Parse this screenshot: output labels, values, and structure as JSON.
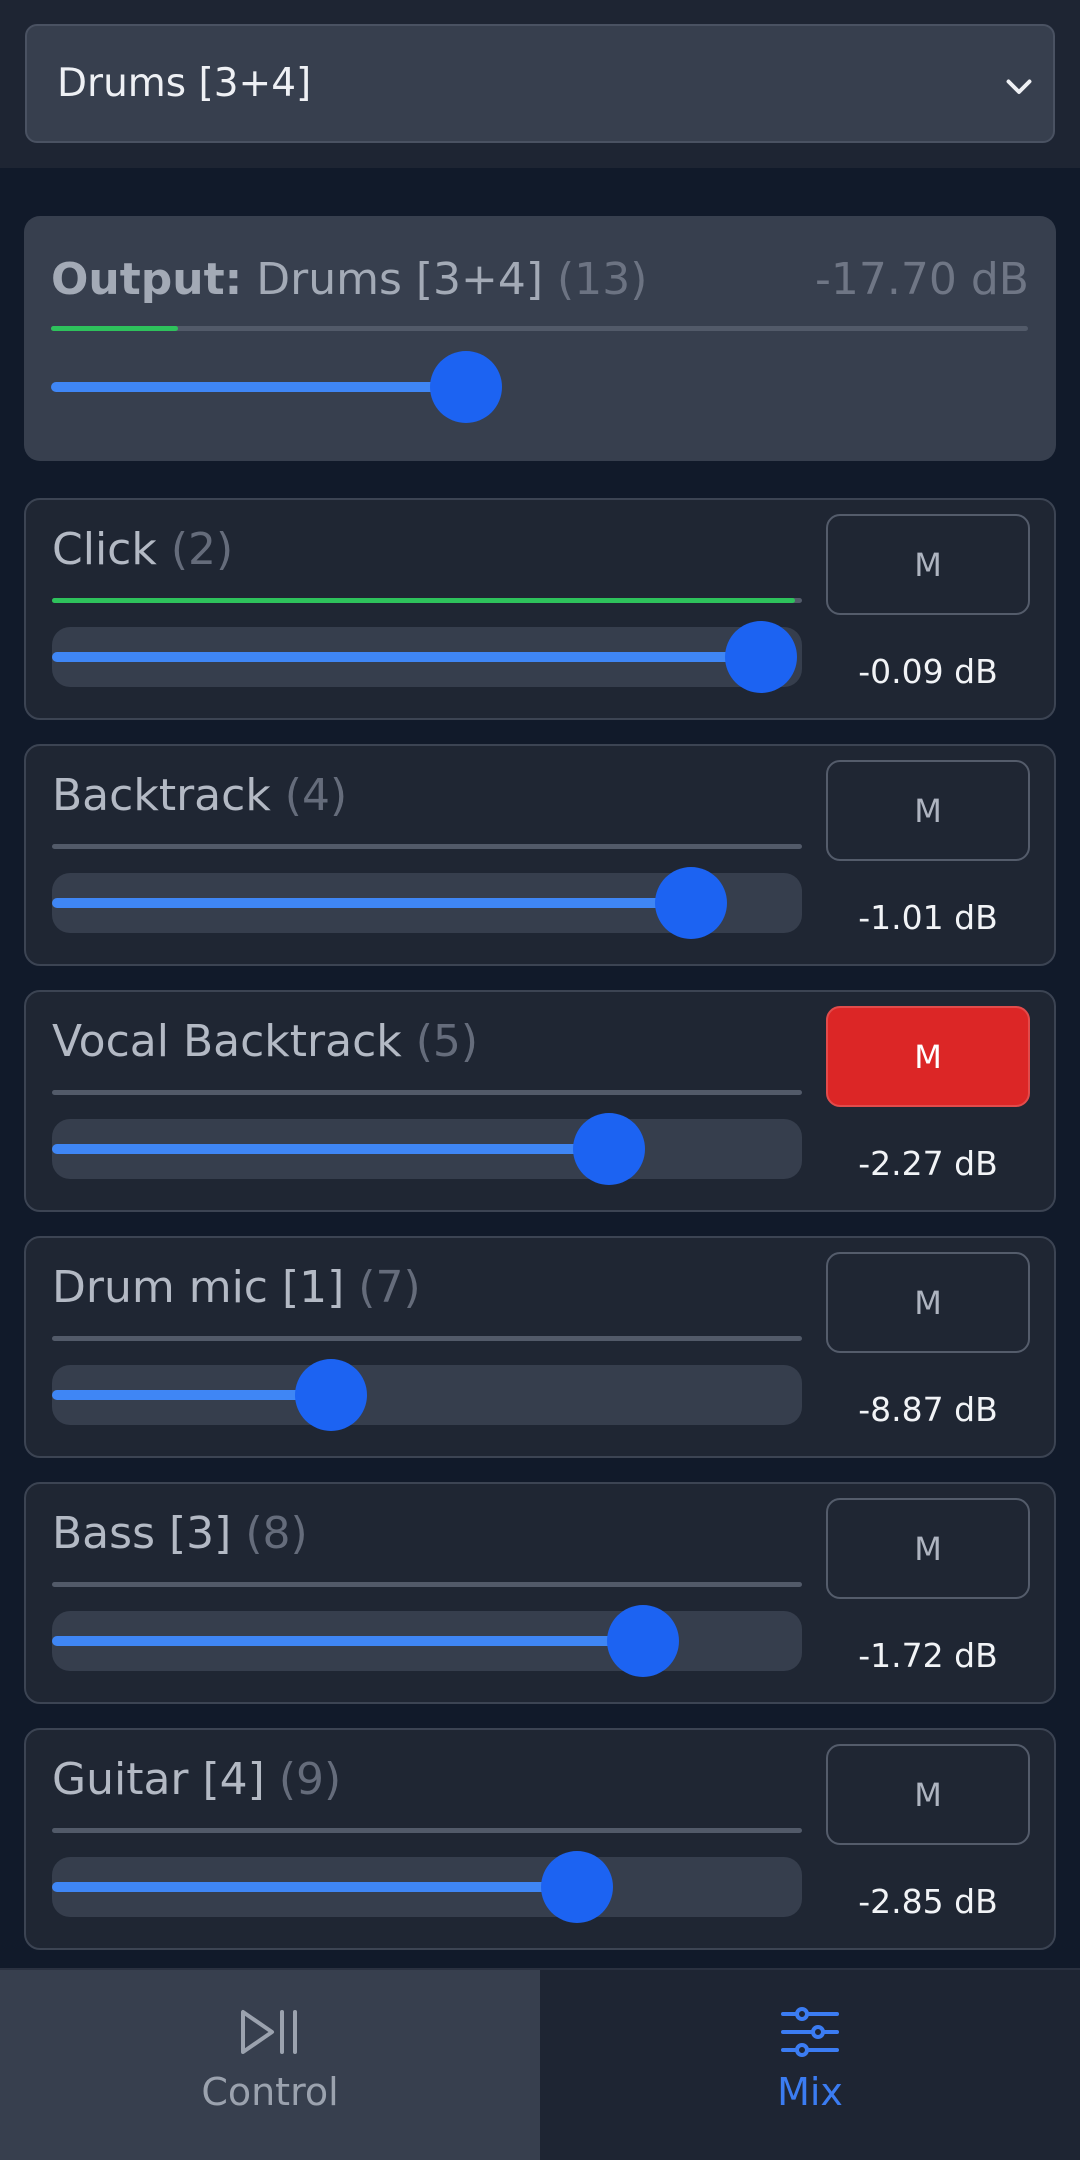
{
  "selector": {
    "value": "Drums [3+4]"
  },
  "output": {
    "label": "Output:",
    "name": "Drums [3+4]",
    "index": "(13)",
    "db": "-17.70 dB",
    "meter_level": 0.13,
    "fader_level": 0.425
  },
  "channels": [
    {
      "name": "Click",
      "index": "(2)",
      "db": "-0.09 dB",
      "mute_label": "M",
      "muted": false,
      "meter_level": 0.99,
      "fader_level": 0.945
    },
    {
      "name": "Backtrack",
      "index": "(4)",
      "db": "-1.01 dB",
      "mute_label": "M",
      "muted": false,
      "meter_level": 0.0,
      "fader_level": 0.852
    },
    {
      "name": "Vocal Backtrack",
      "index": "(5)",
      "db": "-2.27 dB",
      "mute_label": "M",
      "muted": true,
      "meter_level": 0.0,
      "fader_level": 0.743
    },
    {
      "name": "Drum mic [1]",
      "index": "(7)",
      "db": "-8.87 dB",
      "mute_label": "M",
      "muted": false,
      "meter_level": 0.0,
      "fader_level": 0.372
    },
    {
      "name": "Bass [3]",
      "index": "(8)",
      "db": "-1.72 dB",
      "mute_label": "M",
      "muted": false,
      "meter_level": 0.0,
      "fader_level": 0.788
    },
    {
      "name": "Guitar [4]",
      "index": "(9)",
      "db": "-2.85 dB",
      "mute_label": "M",
      "muted": false,
      "meter_level": 0.0,
      "fader_level": 0.7
    }
  ],
  "nav": {
    "control_label": "Control",
    "mix_label": "Mix",
    "active": "Mix",
    "control_icon": "play-pause-icon",
    "mix_icon": "sliders-icon"
  },
  "colors": {
    "accent": "#1c63f2",
    "meter": "#2ec25c",
    "mute_active": "#dc2626"
  }
}
